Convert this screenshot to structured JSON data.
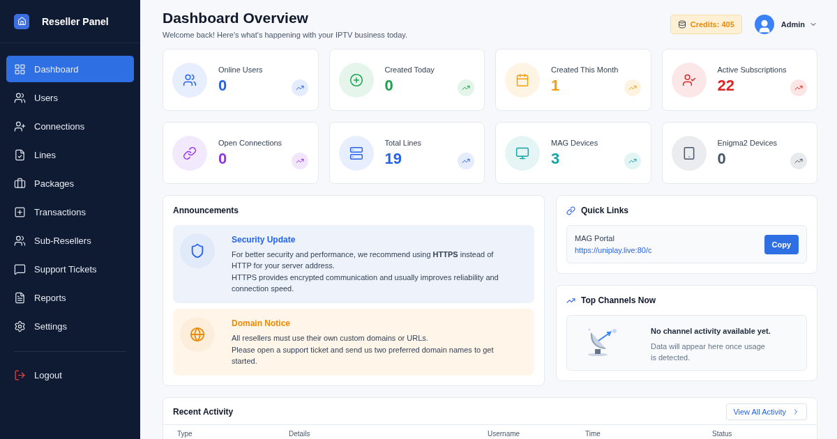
{
  "sidebar": {
    "brand": "Reseller Panel",
    "items": [
      {
        "label": "Dashboard",
        "selected": true,
        "kind": "nav"
      },
      {
        "label": "Users",
        "selected": false,
        "kind": "nav"
      },
      {
        "label": "Connections",
        "selected": false,
        "kind": "nav"
      },
      {
        "label": "Lines",
        "selected": false,
        "kind": "nav"
      },
      {
        "label": "Packages",
        "selected": false,
        "kind": "nav"
      },
      {
        "label": "Transactions",
        "selected": false,
        "kind": "nav"
      },
      {
        "label": "Sub-Resellers",
        "selected": false,
        "kind": "nav"
      },
      {
        "label": "Support Tickets",
        "selected": false,
        "kind": "nav"
      },
      {
        "label": "Reports",
        "selected": false,
        "kind": "nav"
      },
      {
        "label": "Settings",
        "selected": false,
        "kind": "nav"
      },
      {
        "label": "Logout",
        "selected": false,
        "kind": "logout"
      }
    ]
  },
  "header": {
    "title": "Dashboard Overview",
    "subtitle": "Welcome back! Here's what's happening with your IPTV business today.",
    "credits": "Credits: 405",
    "user": "Admin"
  },
  "stats": [
    {
      "label": "Online Users",
      "value": "0",
      "color": "#2563eb"
    },
    {
      "label": "Created Today",
      "value": "0",
      "color": "#16a34a"
    },
    {
      "label": "Created This Month",
      "value": "1",
      "color": "#f59e0b"
    },
    {
      "label": "Active Subscriptions",
      "value": "22",
      "color": "#dc2626"
    },
    {
      "label": "Open Connections",
      "value": "0",
      "color": "#9333ea"
    },
    {
      "label": "Total Lines",
      "value": "19",
      "color": "#2563eb"
    },
    {
      "label": "MAG Devices",
      "value": "3",
      "color": "#14a3a8"
    },
    {
      "label": "Enigma2 Devices",
      "value": "0",
      "color": "#475569"
    }
  ],
  "announcements": {
    "title": "Announcements",
    "items": [
      {
        "kind": "info",
        "title": "Security Update",
        "paragraphs": [
          "For better security and performance, we recommend using **HTTPS** instead of HTTP for your server address.",
          "HTTPS provides encrypted communication and usually improves reliability and connection speed."
        ]
      },
      {
        "kind": "notice",
        "title": "Domain Notice",
        "paragraphs": [
          "All resellers must use their own custom domains or URLs.",
          "Please open a support ticket and send us two preferred domain names to get started."
        ]
      }
    ]
  },
  "quick_links": {
    "title": "Quick Links",
    "label": "MAG Portal",
    "url": "https://uniplay.live:80/c",
    "button": "Copy"
  },
  "top_channels": {
    "title": "Top Channels Now",
    "empty_title": "No channel activity available yet.",
    "empty_text": "Data will appear here once usage is detected."
  },
  "recent_activity": {
    "title": "Recent Activity",
    "button": "View All Activity",
    "columns": [
      "Type",
      "Details",
      "Username",
      "Time",
      "Status"
    ]
  }
}
